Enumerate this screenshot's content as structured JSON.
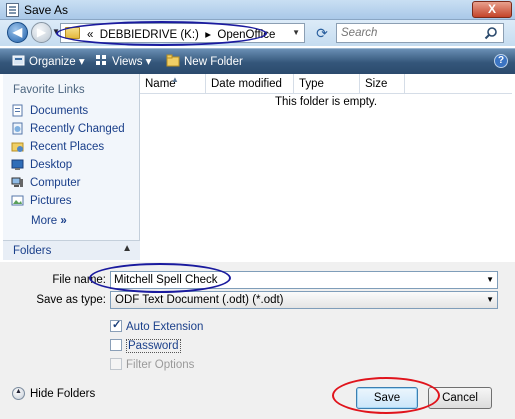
{
  "window": {
    "title": "Save As",
    "close_glyph": "X"
  },
  "address": {
    "path_prefix": "«",
    "path": [
      "DEBBIEDRIVE (K:)",
      "OpenOffice"
    ],
    "path_separator": "▸",
    "search_placeholder": "Search"
  },
  "toolbar": {
    "organize_label": "Organize",
    "views_label": "Views",
    "new_folder_label": "New Folder",
    "help_glyph": "?"
  },
  "favorites": {
    "heading": "Favorite Links",
    "items": [
      {
        "label": "Documents",
        "icon": "documents-icon"
      },
      {
        "label": "Recently Changed",
        "icon": "recently-changed-icon"
      },
      {
        "label": "Recent Places",
        "icon": "recent-places-icon"
      },
      {
        "label": "Desktop",
        "icon": "desktop-icon"
      },
      {
        "label": "Computer",
        "icon": "computer-icon"
      },
      {
        "label": "Pictures",
        "icon": "pictures-icon"
      }
    ],
    "more_label": "More",
    "more_glyph": "»",
    "folders_label": "Folders"
  },
  "file_list": {
    "columns": [
      "Name",
      "Date modified",
      "Type",
      "Size"
    ],
    "empty_message": "This folder is empty."
  },
  "save_form": {
    "file_name_label": "File name:",
    "file_name_value": "Mitchell Spell Check",
    "save_as_type_label": "Save as type:",
    "save_as_type_value": "ODF Text Document (.odt) (*.odt)",
    "auto_extension_label": "Auto Extension",
    "auto_extension_checked": true,
    "password_label": "Password",
    "password_checked": false,
    "filter_options_label": "Filter Options",
    "filter_options_enabled": false
  },
  "footer": {
    "hide_folders_label": "Hide Folders",
    "save_label": "Save",
    "cancel_label": "Cancel"
  },
  "annotations": {
    "address_circle_color": "#1a1a9e",
    "filename_circle_color": "#1a1a9e",
    "save_circle_color": "#e0141c"
  }
}
